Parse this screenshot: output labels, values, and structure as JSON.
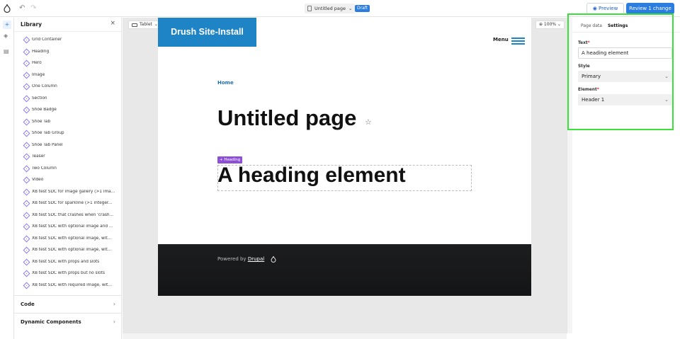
{
  "topbar": {
    "undo_icon": "undo-icon",
    "redo_icon": "redo-icon",
    "page_name": "Untitled page",
    "page_chevron": "⌄",
    "status_badge": "Draft",
    "preview_label": "Preview",
    "preview_icon": "◉",
    "review_label": "Review 1 change",
    "colors": {
      "accent": "#2b7de0"
    }
  },
  "rail": {
    "items": [
      {
        "icon": "plus-icon",
        "glyph": "+"
      },
      {
        "icon": "layers-icon",
        "glyph": "◈"
      },
      {
        "icon": "page-icon",
        "glyph": "▤"
      }
    ]
  },
  "library": {
    "title": "Library",
    "close_glyph": "×",
    "items": [
      "Grid Container",
      "Heading",
      "Hero",
      "Image",
      "One Column",
      "Section",
      "Shoe Badge",
      "Shoe Tab",
      "Shoe Tab Group",
      "Shoe Tab Panel",
      "Teaser",
      "Two Column",
      "Video",
      "XB test SDC for image gallery (>1 ima...",
      "XB test SDC for sparkline (>1 integer...",
      "XB test SDC that crashes when 'crash...",
      "XB test SDC with optional image and ...",
      "XB test SDC with optional image, wit...",
      "XB test SDC with optional image, wit...",
      "XB test SDC with props and slots",
      "XB test SDC with props but no slots",
      "XB test SDC with required image, wit..."
    ],
    "sections": [
      {
        "label": "Code",
        "chevron": "›"
      },
      {
        "label": "Dynamic Components",
        "chevron": "›"
      }
    ],
    "item_color": "#8c7cf0"
  },
  "canvas": {
    "device_label": "Tablet",
    "device_chevron": "⌄",
    "fit_glyph": "⊡",
    "zoom_label": "⊕ 100% ⌄"
  },
  "preview": {
    "site_name": "Drush Site-Install",
    "menu_label": "Menu",
    "breadcrumb": "Home",
    "page_title": "Untitled page",
    "star_glyph": "☆",
    "heading_tag": "+ Heading",
    "heading_text": "A heading element",
    "footer_powered": "Powered by",
    "footer_link": "Drupal",
    "brand_color": "#1f84c6",
    "tag_color": "#8d4fd6"
  },
  "settings": {
    "tabs": [
      "Page data",
      "Settings"
    ],
    "active_tab": "Settings",
    "text_label": "Text",
    "text_value": "A heading element",
    "style_label": "Style",
    "style_value": "Primary",
    "element_label": "Element",
    "element_value": "Header 1",
    "required_mark": "*",
    "select_chevron": "⌄",
    "highlight_color": "#3ce03c"
  }
}
